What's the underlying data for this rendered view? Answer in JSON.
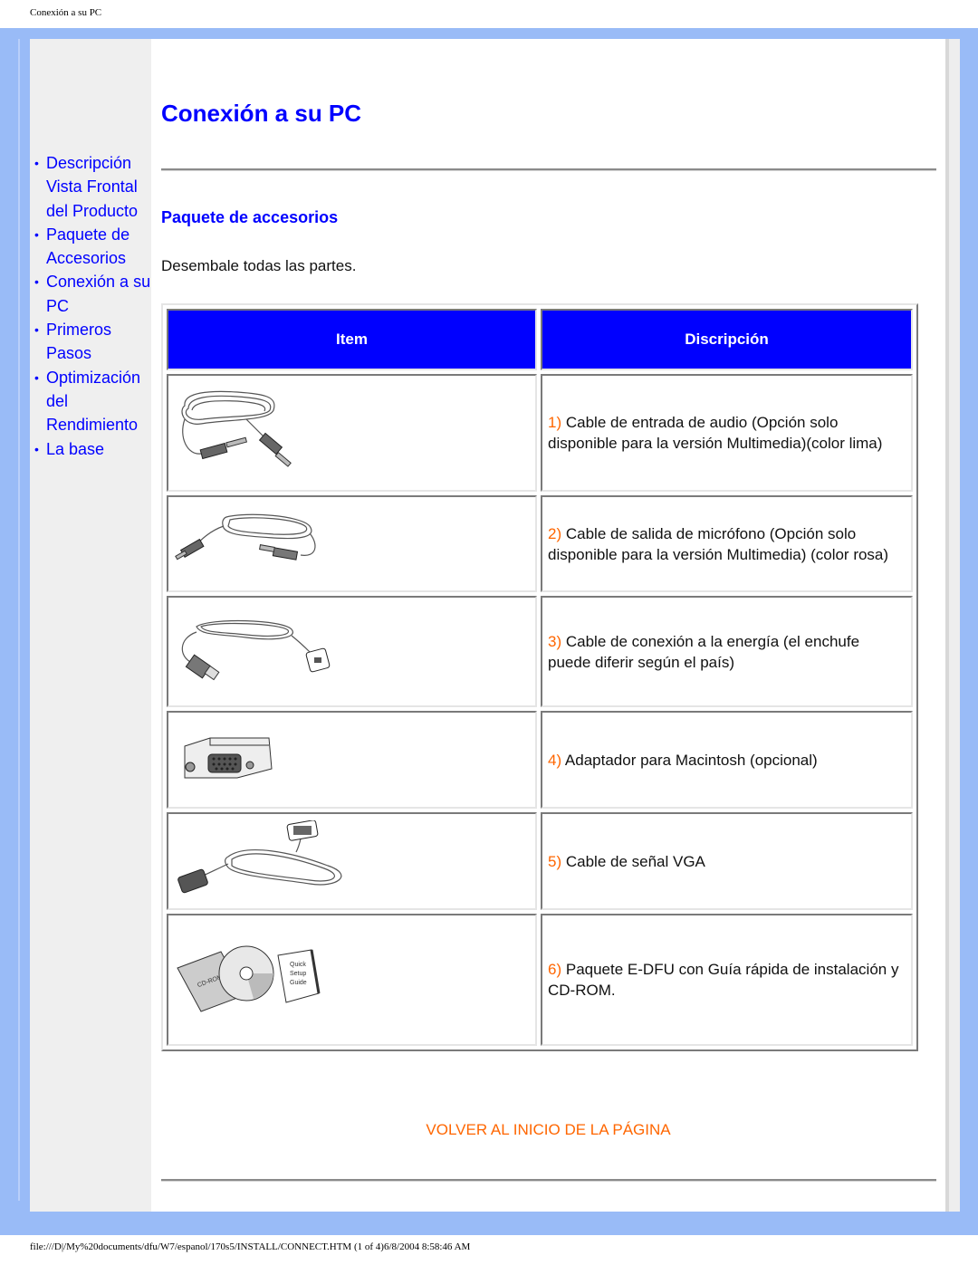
{
  "print_header": "Conexión a su PC",
  "print_footer": "file:///D|/My%20documents/dfu/W7/espanol/170s5/INSTALL/CONNECT.HTM (1 of 4)6/8/2004 8:58:46 AM",
  "sidebar": {
    "items": [
      {
        "label": "Descripción Vista Frontal del Producto"
      },
      {
        "label": "Paquete de Accesorios"
      },
      {
        "label": "Conexión a su PC"
      },
      {
        "label": "Primeros Pasos"
      },
      {
        "label": "Optimización del Rendimiento"
      },
      {
        "label": "La base"
      }
    ]
  },
  "main": {
    "title": "Conexión a su PC",
    "section_title": "Paquete de accesorios",
    "intro": "Desembale todas las partes.",
    "table": {
      "headers": [
        "Item",
        "Discripción"
      ],
      "rows": [
        {
          "image": "audio-cable-icon",
          "num": "1)",
          "text": "Cable de entrada de audio (Opción solo disponible para la versión Multimedia)(color lima)"
        },
        {
          "image": "microphone-cable-icon",
          "num": "2)",
          "text": "Cable de salida de micrófono (Opción solo disponible para la versión Multimedia) (color rosa)"
        },
        {
          "image": "power-cable-icon",
          "num": "3)",
          "text": "Cable de conexión a la energía (el enchufe puede diferir según el país)"
        },
        {
          "image": "mac-adapter-icon",
          "num": "4)",
          "text": "Adaptador para Macintosh (opcional)"
        },
        {
          "image": "vga-cable-icon",
          "num": "5)",
          "text": "Cable de señal VGA"
        },
        {
          "image": "edfu-package-icon",
          "num": "6)",
          "text": "Paquete E-DFU con Guía rápida de instalación y CD-ROM."
        }
      ]
    },
    "back_to_top": "VOLVER AL INICIO DE LA PÁGINA"
  },
  "colors": {
    "link": "#0000ff",
    "accent_orange": "#ff6600",
    "frame": "#99bbf7",
    "sidebar_bg": "#efefef",
    "header_bg": "#0000ff"
  }
}
